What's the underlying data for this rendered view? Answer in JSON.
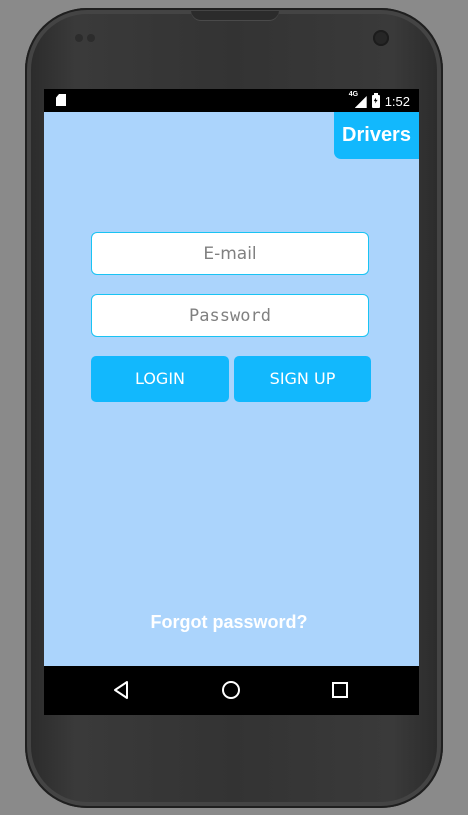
{
  "status_bar": {
    "network_label": "4G",
    "time": "1:52"
  },
  "app": {
    "drivers_label": "Drivers",
    "email_placeholder": "E-mail",
    "email_value": "",
    "password_placeholder": "Password",
    "password_value": "",
    "login_label": "LOGIN",
    "signup_label": "SIGN UP",
    "forgot_label": "Forgot password?"
  },
  "nav_bar": {
    "icons": [
      "back-icon",
      "home-icon",
      "recents-icon"
    ]
  },
  "colors": {
    "app_background": "#abd4fc",
    "accent": "#12b8fd",
    "field_border": "#19c3f3",
    "placeholder_text": "#808080"
  }
}
